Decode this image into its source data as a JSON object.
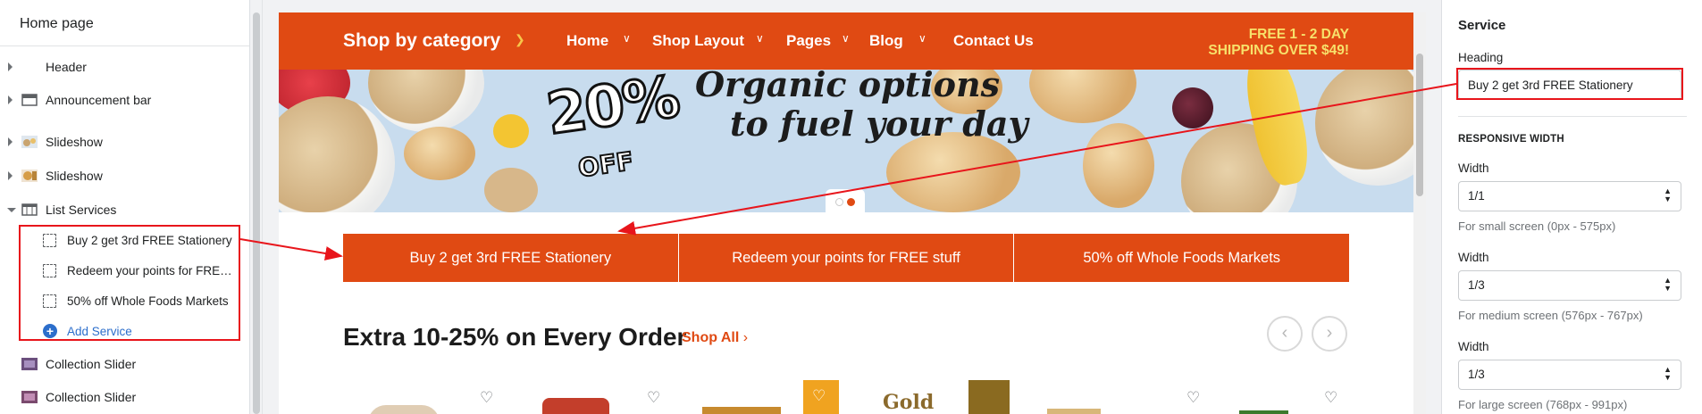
{
  "left_panel": {
    "title": "Home page",
    "sections": [
      {
        "label": "Header"
      },
      {
        "label": "Announcement bar"
      },
      {
        "label": "Slideshow"
      },
      {
        "label": "Slideshow"
      },
      {
        "label": "List Services"
      },
      {
        "label": "Collection Slider"
      },
      {
        "label": "Collection Slider"
      }
    ],
    "services": [
      {
        "label": "Buy 2 get 3rd FREE Stationery"
      },
      {
        "label": "Redeem your points for FREE stuff"
      },
      {
        "label": "50% off Whole Foods Markets"
      }
    ],
    "add_label": "Add Service"
  },
  "preview": {
    "nav": {
      "shop_by_category": "Shop by category",
      "items": [
        {
          "label": "Home"
        },
        {
          "label": "Shop Layout"
        },
        {
          "label": "Pages"
        },
        {
          "label": "Blog"
        },
        {
          "label": "Contact Us"
        }
      ],
      "shipping_line1": "FREE 1 - 2 DAY",
      "shipping_line2": "SHIPPING OVER $49!"
    },
    "banner": {
      "percent": "20%",
      "off": "OFF",
      "headline_line1": "Organic options",
      "headline_line2": "to fuel your day"
    },
    "services": [
      {
        "label": "Buy 2 get 3rd FREE Stationery"
      },
      {
        "label": "Redeem your points for FREE stuff"
      },
      {
        "label": "50% off Whole Foods Markets"
      }
    ],
    "section_title": "Extra 10-25% on Every Order",
    "shop_all": "Shop All",
    "product_brand_text": "Gold"
  },
  "right_panel": {
    "title": "Service",
    "heading_label": "Heading",
    "heading_value": "Buy 2 get 3rd FREE Stationery",
    "responsive_title": "RESPONSIVE WIDTH",
    "widths": [
      {
        "label": "Width",
        "value": "1/1",
        "help": "For small screen (0px - 575px)"
      },
      {
        "label": "Width",
        "value": "1/3",
        "help": "For medium screen (576px - 767px)"
      },
      {
        "label": "Width",
        "value": "1/3",
        "help": "For large screen (768px - 991px)"
      }
    ]
  },
  "colors": {
    "brand_orange": "#e04a13",
    "shipping_yellow": "#f7e16b",
    "annotation_red": "#e8151b",
    "link_blue": "#2c6ecb"
  }
}
